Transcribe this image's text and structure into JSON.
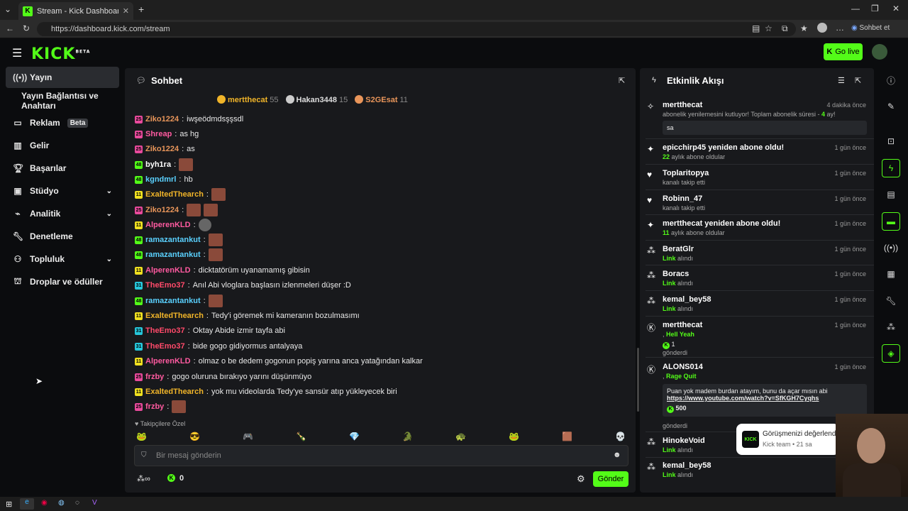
{
  "browser": {
    "tab_title": "Stream - Kick Dashboard",
    "url": "https://dashboard.kick.com/stream",
    "copilot_label": "Sohbet et"
  },
  "header": {
    "logo": "KICK",
    "logo_tag": "BETA",
    "go_live": "Go live"
  },
  "sidebar": {
    "items": [
      {
        "label": "Yayın",
        "icon": "broadcast-icon"
      },
      {
        "label": "Yayın Bağlantısı ve Anahtarı"
      },
      {
        "label": "Reklam",
        "badge": "Beta",
        "icon": "tv-icon"
      },
      {
        "label": "Gelir",
        "icon": "chart-icon"
      },
      {
        "label": "Başarılar",
        "icon": "trophy-icon"
      },
      {
        "label": "Stüdyo",
        "icon": "studio-icon"
      },
      {
        "label": "Analitik",
        "icon": "analytics-icon"
      },
      {
        "label": "Denetleme",
        "icon": "wrench-icon"
      },
      {
        "label": "Topluluk",
        "icon": "community-icon"
      },
      {
        "label": "Droplar ve ödüller",
        "icon": "drops-icon"
      }
    ]
  },
  "chat": {
    "title": "Sohbet",
    "pinned": [
      {
        "user": "mertthecat",
        "count": "55",
        "color": "#f0b429"
      },
      {
        "user": "Hakan3448",
        "count": "15",
        "color": "#cccccc"
      },
      {
        "user": "S2GEsat",
        "count": "11",
        "color": "#e8955a"
      }
    ],
    "messages": [
      {
        "user": "Ziko1224",
        "color": "#e8955a",
        "text": "iwşeödmdsşşsdl"
      },
      {
        "user": "Shreap",
        "color": "#ff5aa0",
        "text": "as hg"
      },
      {
        "user": "Ziko1224",
        "color": "#e8955a",
        "text": "as"
      },
      {
        "user": "byh1ra",
        "color": "#ffffff",
        "text": ""
      },
      {
        "user": "kgndmrl",
        "color": "#5ad1ff",
        "text": "hb"
      },
      {
        "user": "ExaltedThearch",
        "color": "#f0b429",
        "text": ""
      },
      {
        "user": "Ziko1224",
        "color": "#e8955a",
        "text": ""
      },
      {
        "user": "AlperenKLD",
        "color": "#ff5aa0",
        "text": ""
      },
      {
        "user": "ramazantankut",
        "color": "#5ad1ff",
        "text": ""
      },
      {
        "user": "ramazantankut",
        "color": "#5ad1ff",
        "text": ""
      },
      {
        "user": "AlperenKLD",
        "color": "#ff5aa0",
        "text": "dicktatörüm uyanamamış gibisin"
      },
      {
        "user": "TheEmo37",
        "color": "#ff4a6a",
        "text": "Anıl Abi vloglara başlasın izlenmeleri düşer :D"
      },
      {
        "user": "ramazantankut",
        "color": "#5ad1ff",
        "text": ""
      },
      {
        "user": "ExaltedThearch",
        "color": "#f0b429",
        "text": "Tedy'i göremek mi kameranın bozulmasımı"
      },
      {
        "user": "TheEmo37",
        "color": "#ff4a6a",
        "text": "Oktay Abide izmir tayfa abi"
      },
      {
        "user": "TheEmo37",
        "color": "#ff4a6a",
        "text": "bide gogo gidiyormus antalyaya"
      },
      {
        "user": "AlperenKLD",
        "color": "#ff5aa0",
        "text": "olmaz o be dedem gogonun popiş yarına anca yatağından kalkar"
      },
      {
        "user": "frzby",
        "color": "#ff5aa0",
        "text": "gogo oluruna bırakıyo yarını düşünmüyo"
      },
      {
        "user": "ExaltedThearch",
        "color": "#f0b429",
        "text": "yok mu videolarda Tedy'ye sansür atıp yükleyecek biri"
      },
      {
        "user": "frzby",
        "color": "#ff5aa0",
        "text": ""
      }
    ],
    "followers_only": "Takipçilere Özel",
    "input_placeholder": "Bir mesaj gönderin",
    "points": "0",
    "send": "Gönder"
  },
  "activity": {
    "title": "Etkinlik Akışı",
    "events": [
      {
        "name": "mertthecat",
        "time": "4 dakika önce",
        "sub": "abonelik yenilemesini kutluyor! Toplam abonelik süresi - ",
        "highlight": "4",
        "tail": " ay!",
        "message": "sa",
        "icon": "confetti-icon"
      },
      {
        "name": "epicchirp45 yeniden abone oldu!",
        "time": "1 gün önce",
        "highlight": "22",
        "sub": " aylık abone oldular",
        "icon": "sparkle-icon"
      },
      {
        "name": "Toplaritopya",
        "time": "1 gün önce",
        "sub": "kanalı takip etti",
        "icon": "heart-icon"
      },
      {
        "name": "Robinn_47",
        "time": "1 gün önce",
        "sub": "kanalı takip etti",
        "icon": "heart-icon"
      },
      {
        "name": "mertthecat yeniden abone oldu!",
        "time": "1 gün önce",
        "highlight": "11",
        "sub": " aylık abone oldular",
        "icon": "sparkle-icon"
      },
      {
        "name": "BeratGlr",
        "time": "1 gün önce",
        "highlight": "Link",
        "sub": " alındı",
        "icon": "link-icon"
      },
      {
        "name": "Boracs",
        "time": "1 gün önce",
        "highlight": "Link",
        "sub": " alındı",
        "icon": "link-icon"
      },
      {
        "name": "kemal_bey58",
        "time": "1 gün önce",
        "highlight": "Link",
        "sub": " alındı",
        "icon": "link-icon"
      },
      {
        "name": "mertthecat",
        "time": "1 gün önce",
        "highlight": "Hell Yeah",
        "amount": "1",
        "sent": "gönderdi",
        "icon": "kick-icon"
      },
      {
        "name": "ALONS014",
        "time": "1 gün önce",
        "highlight": "Rage Quit",
        "message": "Puan yok madem burdan atayım, bunu da açar mısın abi",
        "link": "https://www.youtube.com/watch?v=SfKGH7Cyqhs",
        "amount": "500",
        "sent": "gönderdi",
        "icon": "kick-icon"
      },
      {
        "name": "HinokeVoid",
        "time": "",
        "highlight": "Link",
        "sub": " alındı",
        "icon": "link-icon"
      },
      {
        "name": "kemal_bey58",
        "time": "",
        "highlight": "Link",
        "sub": " alındı",
        "icon": "link-icon"
      }
    ]
  },
  "toast": {
    "title": "Görüşmenizi değerlendirin",
    "sub": "Kick team • 21 sa"
  }
}
